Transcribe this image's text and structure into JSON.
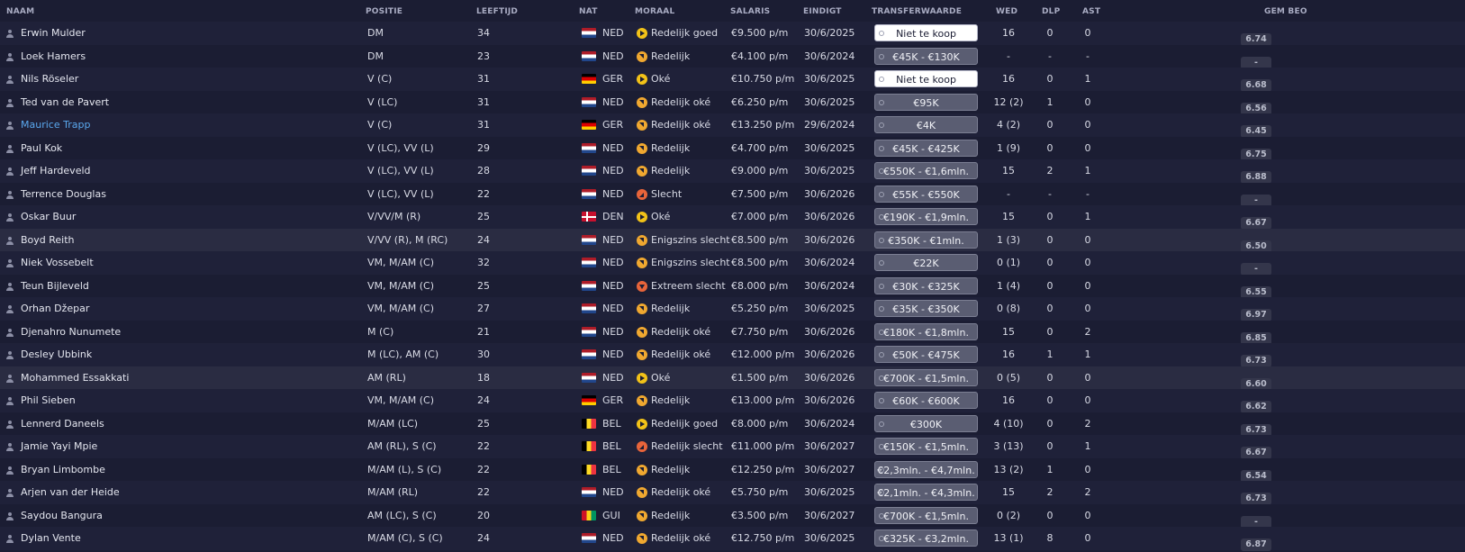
{
  "headers": {
    "naam": "NAAM",
    "positie": "POSITIE",
    "leeftijd": "LEEFTIJD",
    "nat": "NAT",
    "moraal": "MORAAL",
    "salaris": "SALARIS",
    "eindigt": "EINDIGT",
    "transferwaarde": "TRANSFERWAARDE",
    "wed": "WED",
    "dlp": "DLP",
    "ast": "AST",
    "gem_beo": "GEM BEO"
  },
  "colors": {
    "background": "#1b1d33",
    "row_alt": "#1f2139",
    "row_highlight": "#2a2c42",
    "link": "#5aa8ee",
    "morale_good": "#f2c218",
    "morale_ok": "#f0a830",
    "morale_bad": "#e8643a",
    "value_box": "#5a5d72"
  },
  "flags": {
    "NED": [
      "#ae1c28",
      "#ffffff",
      "#21468b"
    ],
    "GER": [
      "#000000",
      "#dd0000",
      "#ffce00"
    ],
    "DEN": "cross",
    "BEL": [
      "#000000",
      "#fdda24",
      "#ef3340"
    ],
    "GUI": [
      "#ce1126",
      "#fcd116",
      "#009460"
    ]
  },
  "players": [
    {
      "name": "Erwin Mulder",
      "pos": "DM",
      "age": "34",
      "nat": "NED",
      "morale": "Redelijk goed",
      "mood": "right",
      "salary": "€9.500 p/m",
      "expiry": "30/6/2025",
      "value": "Niet te koop",
      "nfs": true,
      "apps": "16",
      "pom": "0",
      "ast": "0",
      "rating": "6.74"
    },
    {
      "name": "Loek Hamers",
      "pos": "DM",
      "age": "23",
      "nat": "NED",
      "morale": "Redelijk",
      "mood": "upright",
      "salary": "€4.100 p/m",
      "expiry": "30/6/2024",
      "value": "€45K - €130K",
      "nfs": false,
      "apps": "-",
      "pom": "-",
      "ast": "-",
      "rating": "-"
    },
    {
      "name": "Nils Röseler",
      "pos": "V (C)",
      "age": "31",
      "nat": "GER",
      "morale": "Oké",
      "mood": "right",
      "salary": "€10.750 p/m",
      "expiry": "30/6/2025",
      "value": "Niet te koop",
      "nfs": true,
      "apps": "16",
      "pom": "0",
      "ast": "1",
      "rating": "6.68"
    },
    {
      "name": "Ted van de Pavert",
      "pos": "V (LC)",
      "age": "31",
      "nat": "NED",
      "morale": "Redelijk oké",
      "mood": "upright",
      "salary": "€6.250 p/m",
      "expiry": "30/6/2025",
      "value": "€95K",
      "nfs": false,
      "apps": "12 (2)",
      "pom": "1",
      "ast": "0",
      "rating": "6.56"
    },
    {
      "name": "Maurice Trapp",
      "pos": "V (C)",
      "age": "31",
      "nat": "GER",
      "morale": "Redelijk oké",
      "mood": "upright",
      "salary": "€13.250 p/m",
      "expiry": "29/6/2024",
      "value": "€4K",
      "nfs": false,
      "apps": "4 (2)",
      "pom": "0",
      "ast": "0",
      "rating": "6.45",
      "link": true
    },
    {
      "name": "Paul Kok",
      "pos": "V (LC), VV (L)",
      "age": "29",
      "nat": "NED",
      "morale": "Redelijk",
      "mood": "upright",
      "salary": "€4.700 p/m",
      "expiry": "30/6/2025",
      "value": "€45K - €425K",
      "nfs": false,
      "apps": "1 (9)",
      "pom": "0",
      "ast": "0",
      "rating": "6.75"
    },
    {
      "name": "Jeff Hardeveld",
      "pos": "V (LC), VV (L)",
      "age": "28",
      "nat": "NED",
      "morale": "Redelijk",
      "mood": "upright",
      "salary": "€9.000 p/m",
      "expiry": "30/6/2025",
      "value": "€550K - €1,6mln.",
      "nfs": false,
      "apps": "15",
      "pom": "2",
      "ast": "1",
      "rating": "6.88"
    },
    {
      "name": "Terrence Douglas",
      "pos": "V (LC), VV (L)",
      "age": "22",
      "nat": "NED",
      "morale": "Slecht",
      "mood": "downright",
      "salary": "€7.500 p/m",
      "expiry": "30/6/2026",
      "value": "€55K - €550K",
      "nfs": false,
      "apps": "-",
      "pom": "-",
      "ast": "-",
      "rating": "-"
    },
    {
      "name": "Oskar Buur",
      "pos": "V/VV/M (R)",
      "age": "25",
      "nat": "DEN",
      "morale": "Oké",
      "mood": "right",
      "salary": "€7.000 p/m",
      "expiry": "30/6/2026",
      "value": "€190K - €1,9mln.",
      "nfs": false,
      "apps": "15",
      "pom": "0",
      "ast": "1",
      "rating": "6.67"
    },
    {
      "name": "Boyd Reith",
      "pos": "V/VV (R), M (RC)",
      "age": "24",
      "nat": "NED",
      "morale": "Enigszins slecht",
      "mood": "upright",
      "salary": "€8.500 p/m",
      "expiry": "30/6/2026",
      "value": "€350K - €1mln.",
      "nfs": false,
      "apps": "1 (3)",
      "pom": "0",
      "ast": "0",
      "rating": "6.50",
      "highlight": true
    },
    {
      "name": "Niek Vossebelt",
      "pos": "VM, M/AM (C)",
      "age": "32",
      "nat": "NED",
      "morale": "Enigszins slecht",
      "mood": "upright",
      "salary": "€8.500 p/m",
      "expiry": "30/6/2024",
      "value": "€22K",
      "nfs": false,
      "apps": "0 (1)",
      "pom": "0",
      "ast": "0",
      "rating": "-"
    },
    {
      "name": "Teun Bijleveld",
      "pos": "VM, M/AM (C)",
      "age": "25",
      "nat": "NED",
      "morale": "Extreem slecht",
      "mood": "down",
      "salary": "€8.000 p/m",
      "expiry": "30/6/2024",
      "value": "€30K - €325K",
      "nfs": false,
      "apps": "1 (4)",
      "pom": "0",
      "ast": "0",
      "rating": "6.55"
    },
    {
      "name": "Orhan Džepar",
      "pos": "VM, M/AM (C)",
      "age": "27",
      "nat": "NED",
      "morale": "Redelijk",
      "mood": "upright",
      "salary": "€5.250 p/m",
      "expiry": "30/6/2025",
      "value": "€35K - €350K",
      "nfs": false,
      "apps": "0 (8)",
      "pom": "0",
      "ast": "0",
      "rating": "6.97"
    },
    {
      "name": "Djenahro Nunumete",
      "pos": "M (C)",
      "age": "21",
      "nat": "NED",
      "morale": "Redelijk oké",
      "mood": "upright",
      "salary": "€7.750 p/m",
      "expiry": "30/6/2026",
      "value": "€180K - €1,8mln.",
      "nfs": false,
      "apps": "15",
      "pom": "0",
      "ast": "2",
      "rating": "6.85"
    },
    {
      "name": "Desley Ubbink",
      "pos": "M (LC), AM (C)",
      "age": "30",
      "nat": "NED",
      "morale": "Redelijk oké",
      "mood": "upright",
      "salary": "€12.000 p/m",
      "expiry": "30/6/2026",
      "value": "€50K - €475K",
      "nfs": false,
      "apps": "16",
      "pom": "1",
      "ast": "1",
      "rating": "6.73"
    },
    {
      "name": "Mohammed Essakkati",
      "pos": "AM (RL)",
      "age": "18",
      "nat": "NED",
      "morale": "Oké",
      "mood": "right",
      "salary": "€1.500 p/m",
      "expiry": "30/6/2026",
      "value": "€700K - €1,5mln.",
      "nfs": false,
      "apps": "0 (5)",
      "pom": "0",
      "ast": "0",
      "rating": "6.60",
      "highlight": true
    },
    {
      "name": "Phil Sieben",
      "pos": "VM, M/AM (C)",
      "age": "24",
      "nat": "GER",
      "morale": "Redelijk",
      "mood": "upright",
      "salary": "€13.000 p/m",
      "expiry": "30/6/2026",
      "value": "€60K - €600K",
      "nfs": false,
      "apps": "16",
      "pom": "0",
      "ast": "0",
      "rating": "6.62"
    },
    {
      "name": "Lennerd Daneels",
      "pos": "M/AM (LC)",
      "age": "25",
      "nat": "BEL",
      "morale": "Redelijk goed",
      "mood": "right",
      "salary": "€8.000 p/m",
      "expiry": "30/6/2024",
      "value": "€300K",
      "nfs": false,
      "apps": "4 (10)",
      "pom": "0",
      "ast": "2",
      "rating": "6.73"
    },
    {
      "name": "Jamie Yayi Mpie",
      "pos": "AM (RL), S (C)",
      "age": "22",
      "nat": "BEL",
      "morale": "Redelijk slecht",
      "mood": "downright",
      "salary": "€11.000 p/m",
      "expiry": "30/6/2027",
      "value": "€150K - €1,5mln.",
      "nfs": false,
      "apps": "3 (13)",
      "pom": "0",
      "ast": "1",
      "rating": "6.67"
    },
    {
      "name": "Bryan Limbombe",
      "pos": "M/AM (L), S (C)",
      "age": "22",
      "nat": "BEL",
      "morale": "Redelijk",
      "mood": "upright",
      "salary": "€12.250 p/m",
      "expiry": "30/6/2027",
      "value": "€2,3mln. - €4,7mln.",
      "nfs": false,
      "apps": "13 (2)",
      "pom": "1",
      "ast": "0",
      "rating": "6.54"
    },
    {
      "name": "Arjen van der Heide",
      "pos": "M/AM (RL)",
      "age": "22",
      "nat": "NED",
      "morale": "Redelijk oké",
      "mood": "upright",
      "salary": "€5.750 p/m",
      "expiry": "30/6/2025",
      "value": "€2,1mln. - €4,3mln.",
      "nfs": false,
      "apps": "15",
      "pom": "2",
      "ast": "2",
      "rating": "6.73"
    },
    {
      "name": "Saydou Bangura",
      "pos": "AM (LC), S (C)",
      "age": "20",
      "nat": "GUI",
      "morale": "Redelijk",
      "mood": "upright",
      "salary": "€3.500 p/m",
      "expiry": "30/6/2027",
      "value": "€700K - €1,5mln.",
      "nfs": false,
      "apps": "0 (2)",
      "pom": "0",
      "ast": "0",
      "rating": "-"
    },
    {
      "name": "Dylan Vente",
      "pos": "M/AM (C), S (C)",
      "age": "24",
      "nat": "NED",
      "morale": "Redelijk oké",
      "mood": "upright",
      "salary": "€12.750 p/m",
      "expiry": "30/6/2025",
      "value": "€325K - €3,2mln.",
      "nfs": false,
      "apps": "13 (1)",
      "pom": "8",
      "ast": "0",
      "rating": "6.87"
    }
  ]
}
